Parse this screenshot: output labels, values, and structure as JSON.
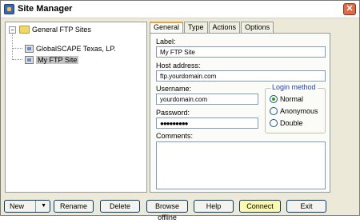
{
  "window": {
    "title": "Site Manager",
    "close_glyph": "✕"
  },
  "tree": {
    "root": {
      "toggle": "−",
      "label": "General FTP Sites"
    },
    "children": [
      {
        "label": "GlobalSCAPE Texas, LP.",
        "selected": false
      },
      {
        "label": "My FTP Site",
        "selected": true
      }
    ]
  },
  "tabs": [
    {
      "label": "General",
      "active": true
    },
    {
      "label": "Type",
      "active": false
    },
    {
      "label": "Actions",
      "active": false
    },
    {
      "label": "Options",
      "active": false
    }
  ],
  "form": {
    "label_label": "Label:",
    "label_value": "My FTP Site",
    "host_label": "Host address:",
    "host_value": "ftp.yourdomain.com",
    "username_label": "Username:",
    "username_value": "yourdomain.com",
    "password_label": "Password:",
    "password_value": "●●●●●●●●●",
    "comments_label": "Comments:",
    "comments_value": ""
  },
  "login_method": {
    "title": "Login method",
    "options": [
      {
        "label": "Normal",
        "checked": true
      },
      {
        "label": "Anonymous",
        "checked": false
      },
      {
        "label": "Double",
        "checked": false
      }
    ]
  },
  "buttons": {
    "new": "New",
    "new_caret": "▼",
    "rename": "Rename",
    "delete": "Delete",
    "browse_offline": "Browse offline",
    "help": "Help",
    "connect": "Connect",
    "exit": "Exit"
  },
  "icons": {
    "app": "site-manager-icon",
    "folder": "folder-icon",
    "site": "ftp-site-icon"
  }
}
